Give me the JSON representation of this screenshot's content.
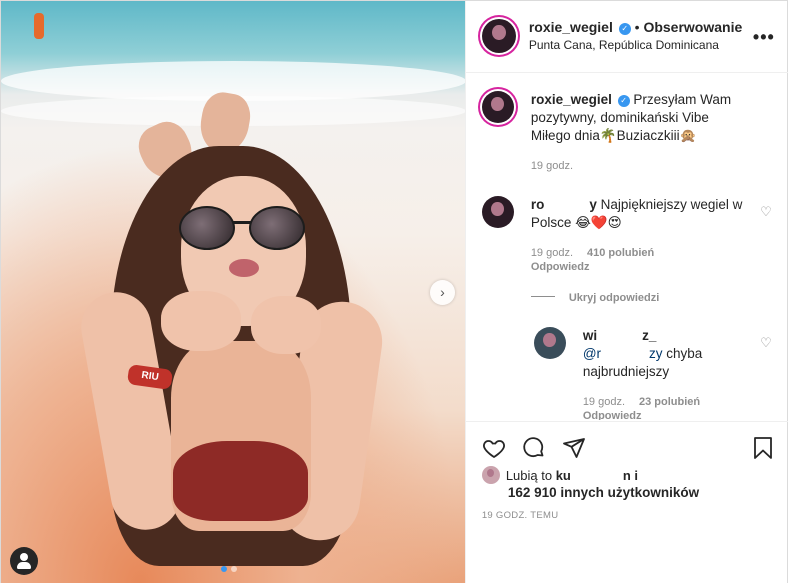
{
  "post": {
    "username": "roxie_wegiel",
    "follow_label": "Obserwowanie",
    "location": "Punta Cana, República Dominicana",
    "more_label": "•••",
    "next_label": "›",
    "wristband_text": "RIU"
  },
  "caption": {
    "username": "roxie_wegiel",
    "text": "Przesyłam Wam pozytywny, dominikański Vibe Miłego dnia🌴Buziaczkiii🙊",
    "time": "19 godz."
  },
  "comments": [
    {
      "username": "ro",
      "username_tail": "y",
      "text": "Najpiękniejszy wegiel w Polsce 😂❤️😍",
      "time": "19 godz.",
      "likes": "410 polubień",
      "reply": "Odpowiedz"
    }
  ],
  "hide_replies_label": "Ukryj odpowiedzi",
  "reply": {
    "username": "wi",
    "username_tail": "z_",
    "mention_start": "@r",
    "mention_end": "zy",
    "text": "chyba najbrudniejszy",
    "time": "19 godz.",
    "likes": "23 polubień",
    "reply": "Odpowiedz"
  },
  "likes": {
    "prefix": "Lubią to",
    "user_start": "ku",
    "user_end": "n i",
    "count_text": "162 910 innych użytkowników"
  },
  "timestamp": "19 GODZ. TEMU",
  "colors": {
    "accent": "#3897f0",
    "text": "#262626",
    "muted": "#8e8e8e",
    "border": "#dbdbdb",
    "heart_red": "#ed4956"
  },
  "icons": [
    "heart-icon",
    "comment-icon",
    "share-icon",
    "bookmark-icon",
    "more-icon",
    "person-tag-icon",
    "chevron-right-icon"
  ]
}
